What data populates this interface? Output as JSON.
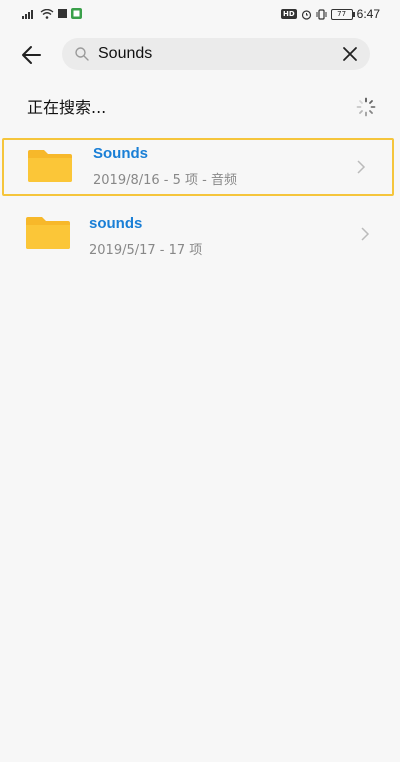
{
  "status_bar": {
    "left_label": "͈",
    "hd": "HD",
    "battery": "77",
    "time": "6:47"
  },
  "search": {
    "value": "Sounds"
  },
  "searching_label": "正在搜索...",
  "results": [
    {
      "title": "Sounds",
      "meta": "2019/8/16 - 5 项 - 音频"
    },
    {
      "title": "sounds",
      "meta": "2019/5/17 - 17 项"
    }
  ],
  "colors": {
    "accent": "#1a7fd6",
    "folder": "#f7b82a",
    "highlight": "#f5c53c"
  }
}
